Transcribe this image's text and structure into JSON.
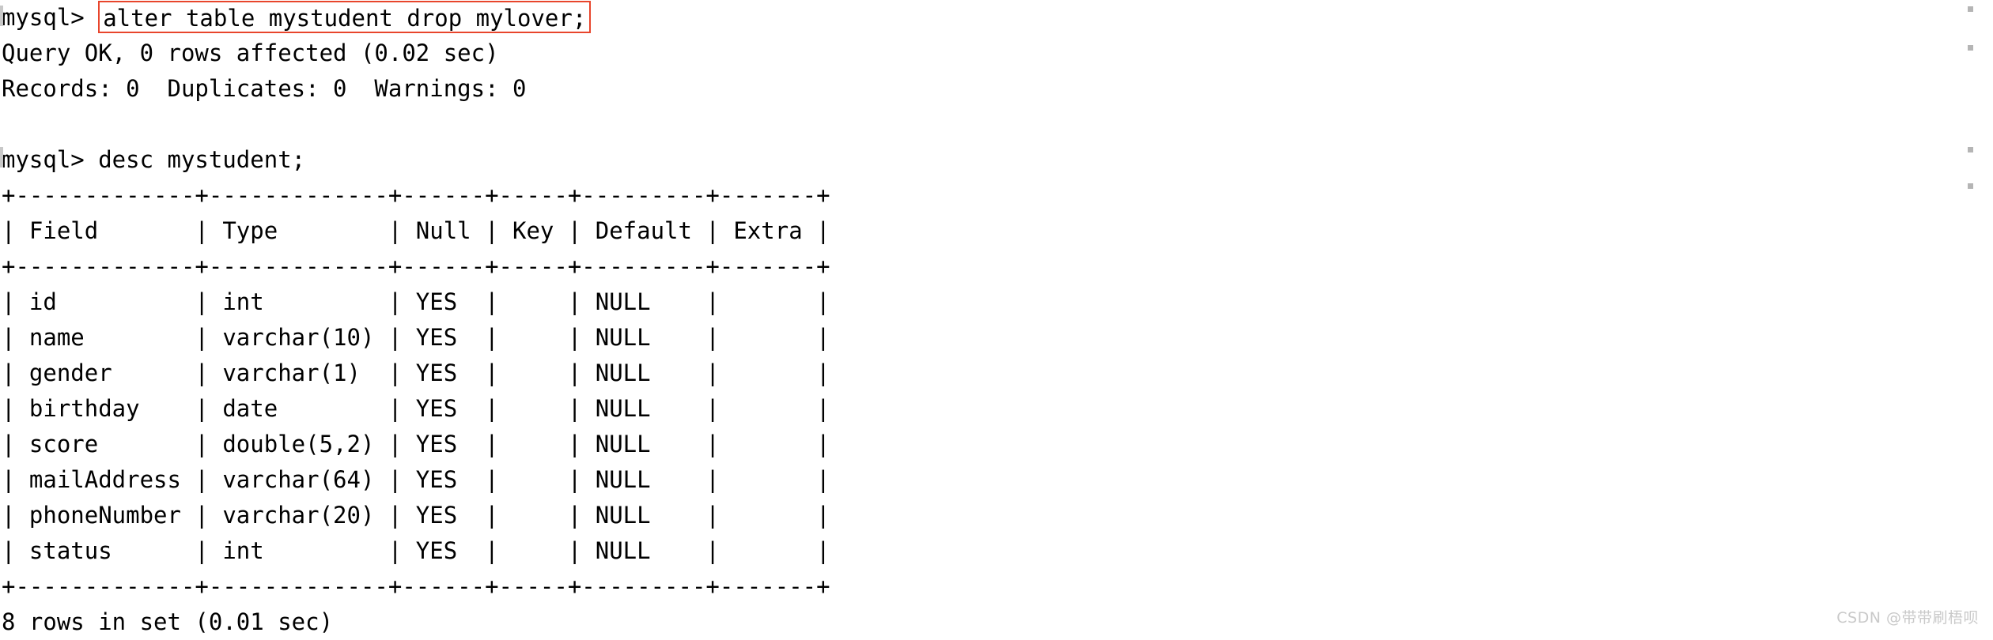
{
  "terminal": {
    "prompt": "mysql> ",
    "highlighted_command": "alter table mystudent drop mylover;",
    "highlight_color": "#e8452c",
    "lines": [
      "Query OK, 0 rows affected (0.02 sec)",
      "Records: 0  Duplicates: 0  Warnings: 0",
      "",
      "mysql> desc mystudent;",
      "+-------------+-------------+------+-----+---------+-------+",
      "| Field       | Type        | Null | Key | Default | Extra |",
      "+-------------+-------------+------+-----+---------+-------+",
      "| id          | int         | YES  |     | NULL    |       |",
      "| name        | varchar(10) | YES  |     | NULL    |       |",
      "| gender      | varchar(1)  | YES  |     | NULL    |       |",
      "| birthday    | date        | YES  |     | NULL    |       |",
      "| score       | double(5,2) | YES  |     | NULL    |       |",
      "| mailAddress | varchar(64) | YES  |     | NULL    |       |",
      "| phoneNumber | varchar(20) | YES  |     | NULL    |       |",
      "| status      | int         | YES  |     | NULL    |       |",
      "+-------------+-------------+------+-----+---------+-------+",
      "8 rows in set (0.01 sec)"
    ],
    "result_table": {
      "columns": [
        "Field",
        "Type",
        "Null",
        "Key",
        "Default",
        "Extra"
      ],
      "rows": [
        [
          "id",
          "int",
          "YES",
          "",
          "NULL",
          ""
        ],
        [
          "name",
          "varchar(10)",
          "YES",
          "",
          "NULL",
          ""
        ],
        [
          "gender",
          "varchar(1)",
          "YES",
          "",
          "NULL",
          ""
        ],
        [
          "birthday",
          "date",
          "YES",
          "",
          "NULL",
          ""
        ],
        [
          "score",
          "double(5,2)",
          "YES",
          "",
          "NULL",
          ""
        ],
        [
          "mailAddress",
          "varchar(64)",
          "YES",
          "",
          "NULL",
          ""
        ],
        [
          "phoneNumber",
          "varchar(20)",
          "YES",
          "",
          "NULL",
          ""
        ],
        [
          "status",
          "int",
          "YES",
          "",
          "NULL",
          ""
        ]
      ],
      "row_count_label": "8 rows in set (0.01 sec)"
    },
    "status_messages": {
      "query_ok": "Query OK, 0 rows affected (0.02 sec)",
      "records": "Records: 0  Duplicates: 0  Warnings: 0"
    }
  },
  "watermark": "CSDN @带带刷梧呗"
}
